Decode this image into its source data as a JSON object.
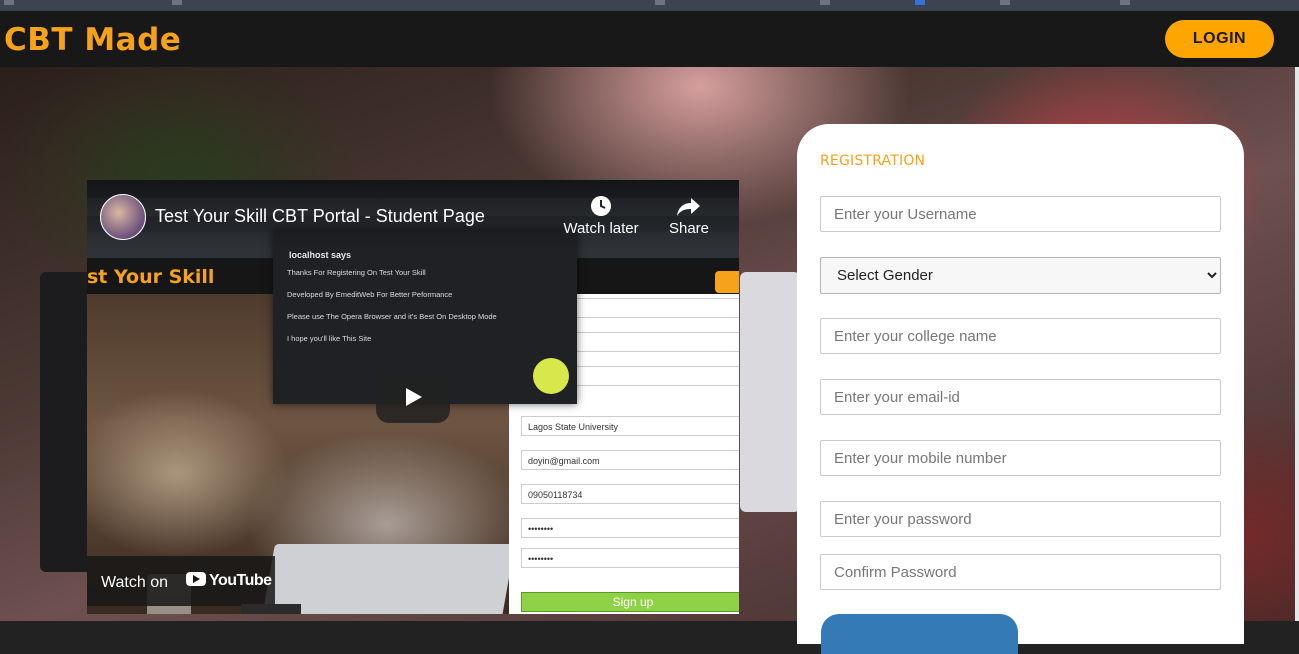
{
  "header": {
    "brand": "CBT Made",
    "login_label": "LOGIN"
  },
  "video": {
    "title": "Test Your Skill CBT Portal - Student Page",
    "watch_later_label": "Watch later",
    "share_label": "Share",
    "watch_on_label": "Watch on",
    "youtube_label": "YouTube",
    "embedded_site": {
      "brand": "st Your Skill",
      "dialog_title": "localhost says",
      "dialog_lines": [
        "Thanks For Registering On Test Your Skill",
        "Developed By EmeditWeb   For Better Peformance",
        "Please use The Opera Browser and it's Best On Desktop Mode",
        "I hope you'll like This Site"
      ],
      "form_values": [
        "Lagos State University",
        "doyin@gmail.com",
        "09050118734",
        "••••••••",
        "••••••••"
      ],
      "signup_label": "Sign up"
    }
  },
  "registration": {
    "title": "REGISTRATION",
    "username_placeholder": "Enter your Username",
    "gender_selected": "Select Gender",
    "college_placeholder": "Enter your college name",
    "email_placeholder": "Enter your email-id",
    "mobile_placeholder": "Enter your mobile number",
    "password_placeholder": "Enter your password",
    "confirm_placeholder": "Confirm Password"
  },
  "colors": {
    "accent": "#f7a21b",
    "header_bg": "#181818",
    "login_bg": "#ffa500",
    "submit_bg": "#337ab7"
  }
}
